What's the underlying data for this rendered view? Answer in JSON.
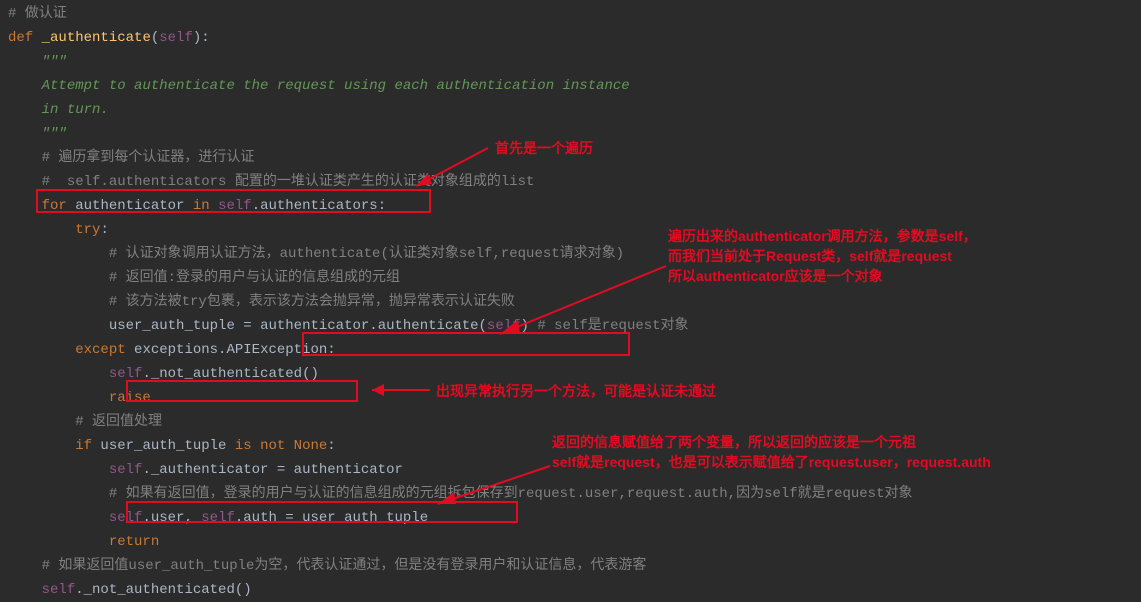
{
  "code": {
    "l1_comment": "# 做认证",
    "l2_def": "def",
    "l2_name": "_authenticate",
    "l2_open": "(",
    "l2_self": "self",
    "l2_close": "):",
    "l3_q": "\"\"\"",
    "l4_doc": "Attempt to authenticate the request using each authentication instance",
    "l5_doc": "in turn.",
    "l6_q": "\"\"\"",
    "l7_comment": "# 遍历拿到每个认证器，进行认证",
    "l8_comment": "#  self.authenticators 配置的一堆认证类产生的认证类对象组成的list",
    "l9_for": "for",
    "l9_auth": "authenticator",
    "l9_in": "in",
    "l9_self": "self",
    "l9_dot": ".",
    "l9_attrs": "authenticators",
    "l9_colon": ":",
    "l10_try": "try",
    "l10_colon": ":",
    "l11_comment": "# 认证对象调用认证方法，authenticate(认证类对象self,request请求对象)",
    "l12_comment": "# 返回值:登录的用户与认证的信息组成的元组",
    "l13_comment": "# 该方法被try包裹，表示该方法会抛异常，抛异常表示认证失败",
    "l14_assign": "user_auth_tuple = ",
    "l14_target": "authenticator",
    "l14_dot": ".",
    "l14_meth": "authenticate",
    "l14_open": "(",
    "l14_self": "self",
    "l14_close": ")",
    "l14_comment": " # self是request对象",
    "l15_except": "except",
    "l15_exc": " exceptions.APIException:",
    "l16_self": "self",
    "l16_dot": ".",
    "l16_meth": "_not_authenticated",
    "l16_call": "()",
    "l17_raise": "raise",
    "l18_comment": "# 返回值处理",
    "l19_if": "if",
    "l19_var": " user_auth_tuple ",
    "l19_isnot": "is not ",
    "l19_none": "None",
    "l19_colon": ":",
    "l20_self": "self",
    "l20_dot": ".",
    "l20_attr": "_authenticator",
    "l20_eq": " = authenticator",
    "l21_comment": "# 如果有返回值，登录的用户与认证的信息组成的元组拆包保存到request.user,request.auth,因为self就是request对象",
    "l22_self1": "self",
    "l22_d1": ".",
    "l22_user": "user",
    "l22_comma": ", ",
    "l22_self2": "self",
    "l22_d2": ".",
    "l22_auth": "auth",
    "l22_eq": " = user_auth_tuple",
    "l23_return": "return",
    "l24_comment": "# 如果返回值user_auth_tuple为空，代表认证通过，但是没有登录用户和认证信息，代表游客",
    "l25_self": "self",
    "l25_dot": ".",
    "l25_meth": "_not_authenticated",
    "l25_call": "()"
  },
  "annotations": {
    "a1": "首先是一个遍历",
    "a2": "遍历出来的authenticator调用方法，参数是self，\n而我们当前处于Request类，self就是request\n所以authenticator应该是一个对象",
    "a3": "出现异常执行另一个方法，可能是认证未通过",
    "a4": "返回的信息赋值给了两个变量，所以返回的应该是一个元祖\nself就是request，也是可以表示赋值给了request.user，request.auth"
  }
}
